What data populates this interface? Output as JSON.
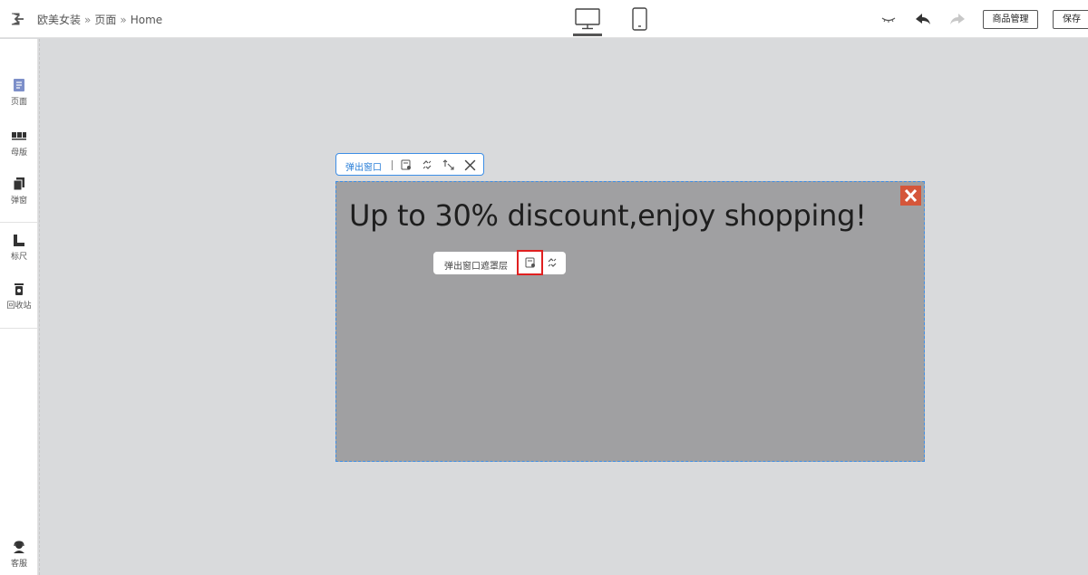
{
  "header": {
    "breadcrumb": [
      "欧美女装",
      "页面",
      "Home"
    ],
    "breadcrumb_separator": "»",
    "goods_button": "商品管理",
    "save_button": "保存"
  },
  "sidebar": {
    "items": [
      {
        "label": "页面",
        "icon": "page-icon"
      },
      {
        "label": "母版",
        "icon": "master-icon"
      },
      {
        "label": "弹窗",
        "icon": "popup-icon"
      },
      {
        "label": "标尺",
        "icon": "ruler-icon"
      },
      {
        "label": "回收站",
        "icon": "trash-icon"
      }
    ],
    "support": {
      "label": "客服",
      "icon": "support-icon"
    }
  },
  "canvas": {
    "popup_toolbar_label": "弹出窗口",
    "popup_headline": "Up to 30% discount,enjoy shopping!",
    "mask_toolbar_label": "弹出窗口遮罩层"
  },
  "colors": {
    "accent": "#3d8ee6",
    "close_button": "#d5563a",
    "highlight": "#e02020",
    "popup_background": "#a0a0a2",
    "canvas_background": "#d9dadc"
  }
}
